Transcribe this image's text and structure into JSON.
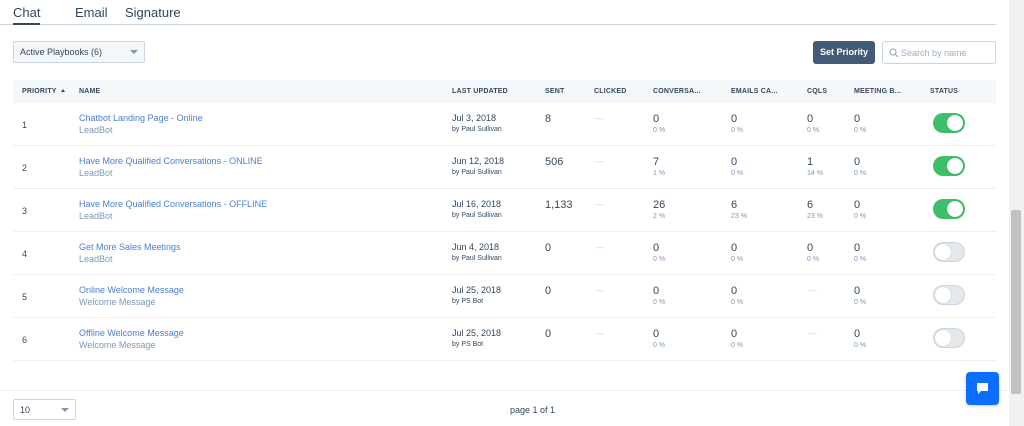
{
  "tabs": [
    {
      "label": "Chat",
      "active": true
    },
    {
      "label": "Email",
      "active": false
    },
    {
      "label": "Signature",
      "active": false
    }
  ],
  "filter": {
    "selected": "Active Playbooks (6)"
  },
  "actions": {
    "set_priority": "Set Priority"
  },
  "search": {
    "placeholder": "Search by name",
    "value": ""
  },
  "table": {
    "headers": {
      "priority": "PRIORITY",
      "name": "NAME",
      "last_updated": "LAST UPDATED",
      "sent": "SENT",
      "clicked": "CLICKED",
      "conversations": "CONVERSA...",
      "emails": "EMAILS CA...",
      "cqls": "CQLS",
      "meetings": "MEETING B...",
      "status": "STATUS"
    },
    "rows": [
      {
        "priority": "1",
        "name": "Chatbot Landing Page - Online",
        "sub": "LeadBot",
        "date": "Jul 3, 2018",
        "by": "by Paul Sullivan",
        "sent": "8",
        "clicked": "—",
        "conv": "0",
        "conv_pct": "0 %",
        "emails": "0",
        "emails_pct": "0 %",
        "cqls": "0",
        "cqls_pct": "0 %",
        "meet": "0",
        "meet_pct": "0 %",
        "status": "on"
      },
      {
        "priority": "2",
        "name": "Have More Qualified Conversations - ONLINE",
        "sub": "LeadBot",
        "date": "Jun 12, 2018",
        "by": "by Paul Sullivan",
        "sent": "506",
        "clicked": "—",
        "conv": "7",
        "conv_pct": "1 %",
        "emails": "0",
        "emails_pct": "0 %",
        "cqls": "1",
        "cqls_pct": "14 %",
        "meet": "0",
        "meet_pct": "0 %",
        "status": "on"
      },
      {
        "priority": "3",
        "name": "Have More Qualified Conversations - OFFLINE",
        "sub": "LeadBot",
        "date": "Jul 16, 2018",
        "by": "by Paul Sullivan",
        "sent": "1,133",
        "clicked": "—",
        "conv": "26",
        "conv_pct": "2 %",
        "emails": "6",
        "emails_pct": "23 %",
        "cqls": "6",
        "cqls_pct": "23 %",
        "meet": "0",
        "meet_pct": "0 %",
        "status": "on"
      },
      {
        "priority": "4",
        "name": "Get More Sales Meetings",
        "sub": "LeadBot",
        "date": "Jun 4, 2018",
        "by": "by Paul Sullivan",
        "sent": "0",
        "clicked": "—",
        "conv": "0",
        "conv_pct": "0 %",
        "emails": "0",
        "emails_pct": "0 %",
        "cqls": "0",
        "cqls_pct": "0 %",
        "meet": "0",
        "meet_pct": "0 %",
        "status": "off"
      },
      {
        "priority": "5",
        "name": "Online Welcome Message",
        "sub": "Welcome Message",
        "date": "Jul 25, 2018",
        "by": "by PS Bot",
        "sent": "0",
        "clicked": "—",
        "conv": "0",
        "conv_pct": "0 %",
        "emails": "0",
        "emails_pct": "0 %",
        "cqls": "—",
        "cqls_pct": "",
        "meet": "0",
        "meet_pct": "0 %",
        "status": "off"
      },
      {
        "priority": "6",
        "name": "Offline Welcome Message",
        "sub": "Welcome Message",
        "date": "Jul 25, 2018",
        "by": "by PS Bot",
        "sent": "0",
        "clicked": "—",
        "conv": "0",
        "conv_pct": "0 %",
        "emails": "0",
        "emails_pct": "0 %",
        "cqls": "—",
        "cqls_pct": "",
        "meet": "0",
        "meet_pct": "0 %",
        "status": "off"
      }
    ]
  },
  "pagination": {
    "page_size": "10",
    "info": "page 1 of 1"
  },
  "colors": {
    "toggle_on": "#3cbf68",
    "link": "#4a7fd1",
    "primary_button": "#425b76",
    "chat_button": "#0d6efd"
  },
  "icons": {
    "search": "search-icon",
    "chat": "chat-bubble-icon",
    "sort": "sort-ascending-icon"
  }
}
